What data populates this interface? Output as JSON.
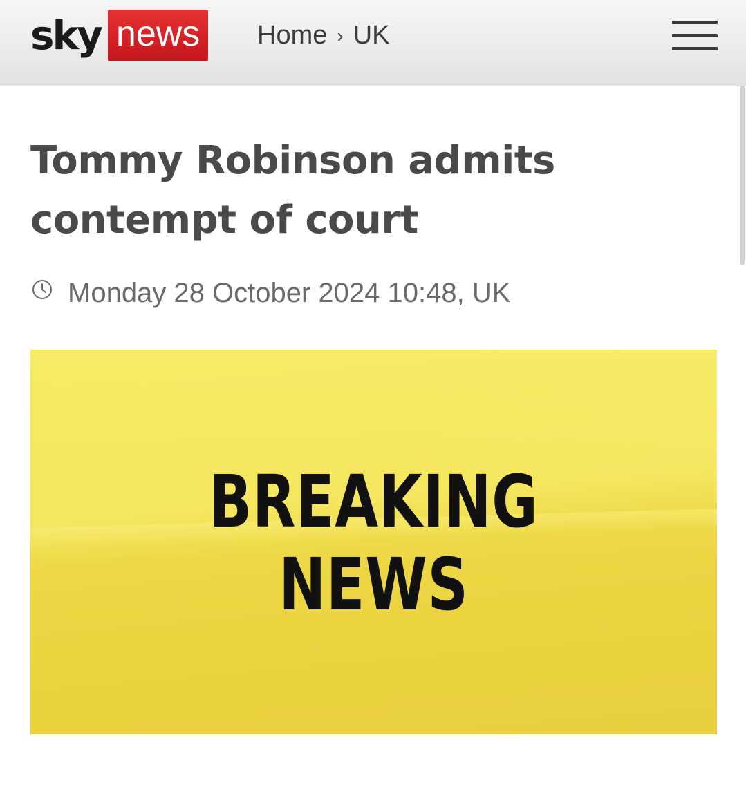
{
  "header": {
    "logo": {
      "sky": "sky",
      "news": "news"
    },
    "breadcrumb": [
      {
        "label": "Home"
      },
      {
        "label": "UK"
      }
    ],
    "breadcrumb_separator": "›",
    "menu_icon": "hamburger-menu-icon"
  },
  "article": {
    "headline": "Tommy Robinson admits contempt of court",
    "timestamp": "Monday 28 October 2024 10:48, UK",
    "timestamp_icon": "clock-icon",
    "hero_image": {
      "line1": "BREAKING",
      "line2": "NEWS",
      "background_color": "#f0dc48"
    }
  },
  "colors": {
    "brand_red": "#c4161c",
    "headline_text": "#4a4a4a",
    "meta_text": "#6a6a6a"
  }
}
